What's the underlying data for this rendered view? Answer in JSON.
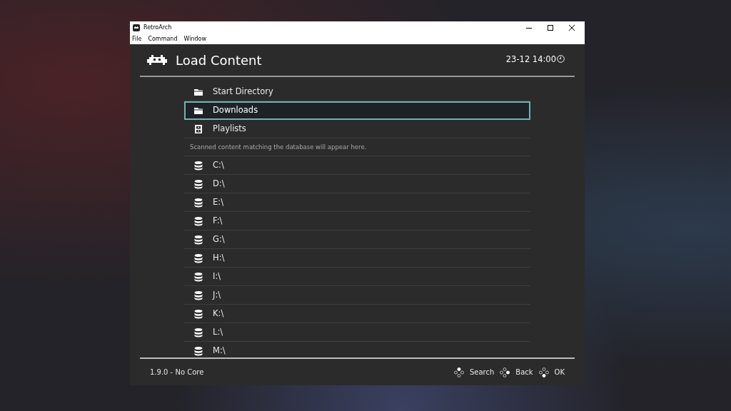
{
  "window": {
    "title": "RetroArch"
  },
  "menu": [
    "File",
    "Command",
    "Window"
  ],
  "header": {
    "title": "Load Content",
    "clock": "23-12 14:00"
  },
  "items": [
    {
      "kind": "folder",
      "label": "Start Directory",
      "selected": false
    },
    {
      "kind": "folder",
      "label": "Downloads",
      "selected": true
    },
    {
      "kind": "playlist",
      "label": "Playlists",
      "selected": false
    },
    {
      "kind": "note",
      "label": "Scanned content matching the database will appear here."
    },
    {
      "kind": "drive",
      "label": "C:\\",
      "selected": false
    },
    {
      "kind": "drive",
      "label": "D:\\",
      "selected": false
    },
    {
      "kind": "drive",
      "label": "E:\\",
      "selected": false
    },
    {
      "kind": "drive",
      "label": "F:\\",
      "selected": false
    },
    {
      "kind": "drive",
      "label": "G:\\",
      "selected": false
    },
    {
      "kind": "drive",
      "label": "H:\\",
      "selected": false
    },
    {
      "kind": "drive",
      "label": "I:\\",
      "selected": false
    },
    {
      "kind": "drive",
      "label": "J:\\",
      "selected": false
    },
    {
      "kind": "drive",
      "label": "K:\\",
      "selected": false
    },
    {
      "kind": "drive",
      "label": "L:\\",
      "selected": false
    },
    {
      "kind": "drive",
      "label": "M:\\",
      "selected": false
    }
  ],
  "footer": {
    "status": "1.9.0 - No Core",
    "actions": [
      {
        "kind": "top",
        "label": "Search"
      },
      {
        "kind": "right",
        "label": "Back"
      },
      {
        "kind": "bottom",
        "label": "OK"
      }
    ]
  }
}
